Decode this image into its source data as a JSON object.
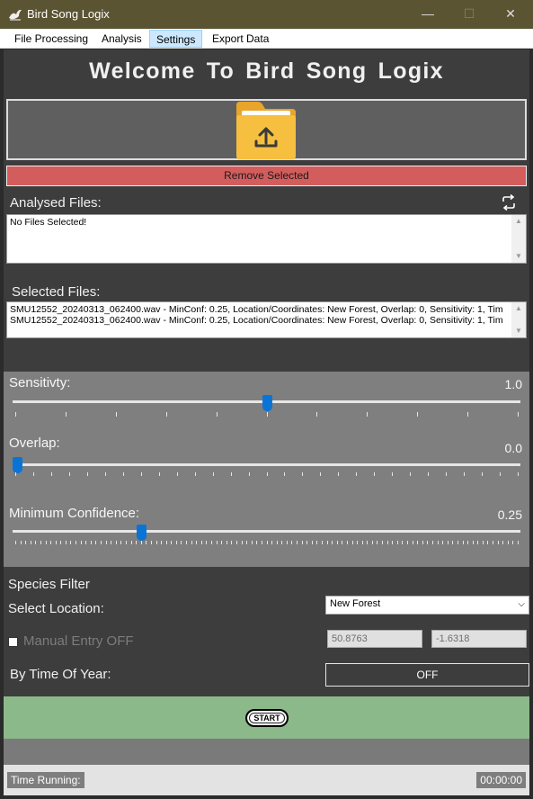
{
  "window": {
    "title": "Bird Song Logix",
    "controls": {
      "minimize": "—",
      "maximize": "☐",
      "close": "✕"
    }
  },
  "menu": {
    "items": [
      {
        "label": "File Processing"
      },
      {
        "label": "Analysis"
      },
      {
        "label": "Settings",
        "active": true
      },
      {
        "label": "Export Data"
      }
    ]
  },
  "header": {
    "welcome": "Welcome To Bird Song Logix"
  },
  "upload": {
    "icon": "folder-upload-icon",
    "remove_label": "Remove Selected"
  },
  "analysed": {
    "label": "Analysed Files:",
    "refresh_icon": "refresh-icon",
    "items": [
      "No Files Selected!"
    ]
  },
  "selected": {
    "label": "Selected Files:",
    "items": [
      "SMU12552_20240313_062400.wav - MinConf: 0.25, Location/Coordinates: New Forest, Overlap: 0, Sensitivity: 1, Tim",
      "SMU12552_20240313_062400.wav - MinConf: 0.25, Location/Coordinates: New Forest, Overlap: 0, Sensitivity: 1, Tim"
    ]
  },
  "sliders": {
    "sensitivity": {
      "label": "Sensitivty:",
      "value": "1.0",
      "position": 0.5
    },
    "overlap": {
      "label": "Overlap:",
      "value": "0.0",
      "position": 0.0
    },
    "min_confidence": {
      "label": "Minimum Confidence:",
      "value": "0.25",
      "position": 0.25
    }
  },
  "species": {
    "title": "Species Filter",
    "location_label": "Select Location:",
    "location_value": "New Forest",
    "manual_label": "Manual Entry OFF",
    "manual_checked": false,
    "latitude": "50.8763",
    "longitude": "-1.6318",
    "time_label": "By Time Of Year:",
    "time_toggle": "OFF"
  },
  "start": {
    "label": "START"
  },
  "status": {
    "time_label": "Time Running:",
    "time_value": "00:00:00"
  },
  "colors": {
    "titlebar": "#5b5432",
    "panel": "#3d3d3d",
    "remove_button": "#d35d5d",
    "slider_panel": "#7f7f7f",
    "slider_thumb": "#0a74d6",
    "start_panel": "#8bb98a",
    "folder": "#f6bf3f"
  }
}
